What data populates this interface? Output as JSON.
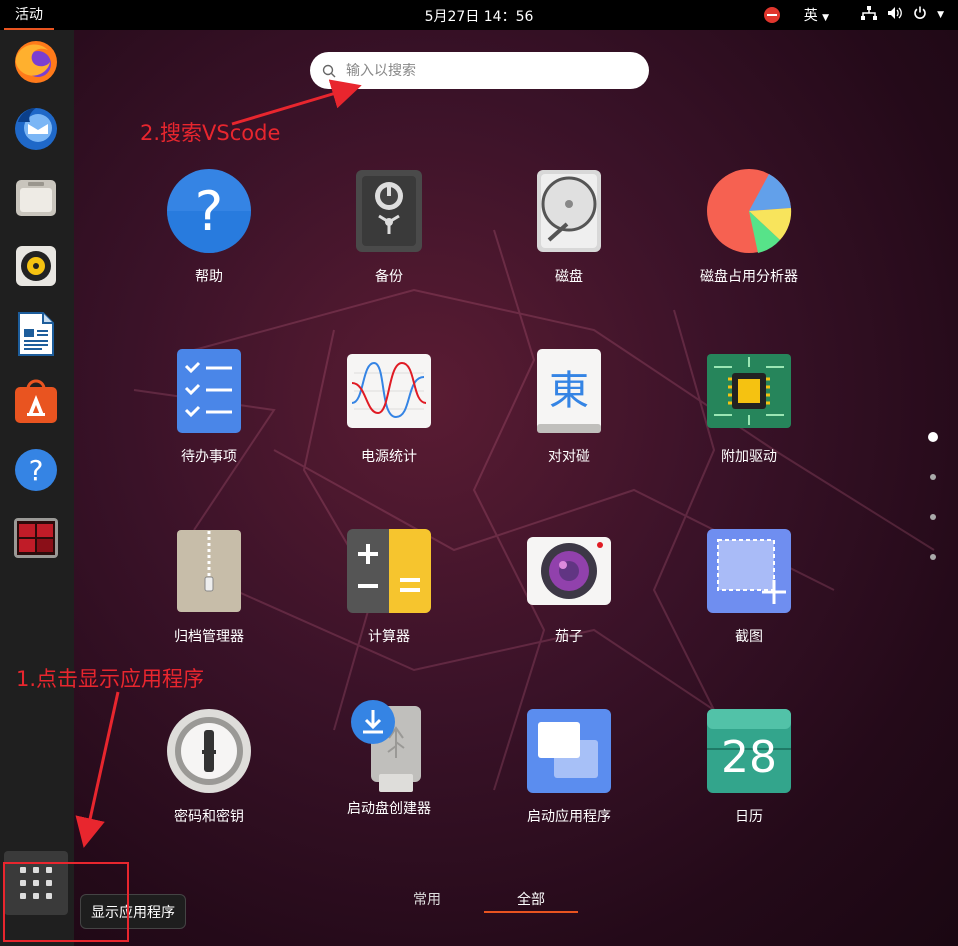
{
  "topbar": {
    "activities": "活动",
    "datetime": "5月27日  14：56",
    "lang": "英"
  },
  "search": {
    "placeholder": "输入以搜索"
  },
  "apps": [
    {
      "label": "帮助",
      "icon": "help-icon"
    },
    {
      "label": "备份",
      "icon": "backup-safe-icon"
    },
    {
      "label": "磁盘",
      "icon": "disk-icon"
    },
    {
      "label": "磁盘占用分析器",
      "icon": "disk-usage-pie-icon"
    },
    {
      "label": "待办事项",
      "icon": "todo-list-icon"
    },
    {
      "label": "电源统计",
      "icon": "power-statistics-icon"
    },
    {
      "label": "对对碰",
      "icon": "mahjongg-tile-icon"
    },
    {
      "label": "附加驱动",
      "icon": "chip-driver-icon"
    },
    {
      "label": "归档管理器",
      "icon": "archive-zipper-icon"
    },
    {
      "label": "计算器",
      "icon": "calculator-icon"
    },
    {
      "label": "茄子",
      "icon": "camera-cheese-icon"
    },
    {
      "label": "截图",
      "icon": "screenshot-icon"
    },
    {
      "label": "密码和密钥",
      "icon": "keyring-icon"
    },
    {
      "label": "启动盘创建器",
      "icon": "usb-creator-icon"
    },
    {
      "label": "启动应用程序",
      "icon": "startup-apps-icon"
    },
    {
      "label": "日历",
      "icon": "calendar-icon"
    }
  ],
  "calendar_day": "28",
  "mahjongg_char": "東",
  "tabs": {
    "frequent": "常用",
    "all": "全部",
    "active": "all"
  },
  "dock": {
    "items": [
      "firefox-icon",
      "thunderbird-icon",
      "files-icon",
      "rhythmbox-icon",
      "writer-icon",
      "software-icon",
      "help-icon",
      "terminal-icon"
    ],
    "show_apps_tooltip": "显示应用程序"
  },
  "annotations": {
    "step1": "1.点击显示应用程序",
    "step2": "2.搜索VScode"
  },
  "colors": {
    "accent": "#e95420",
    "annotation": "#e8262e"
  }
}
